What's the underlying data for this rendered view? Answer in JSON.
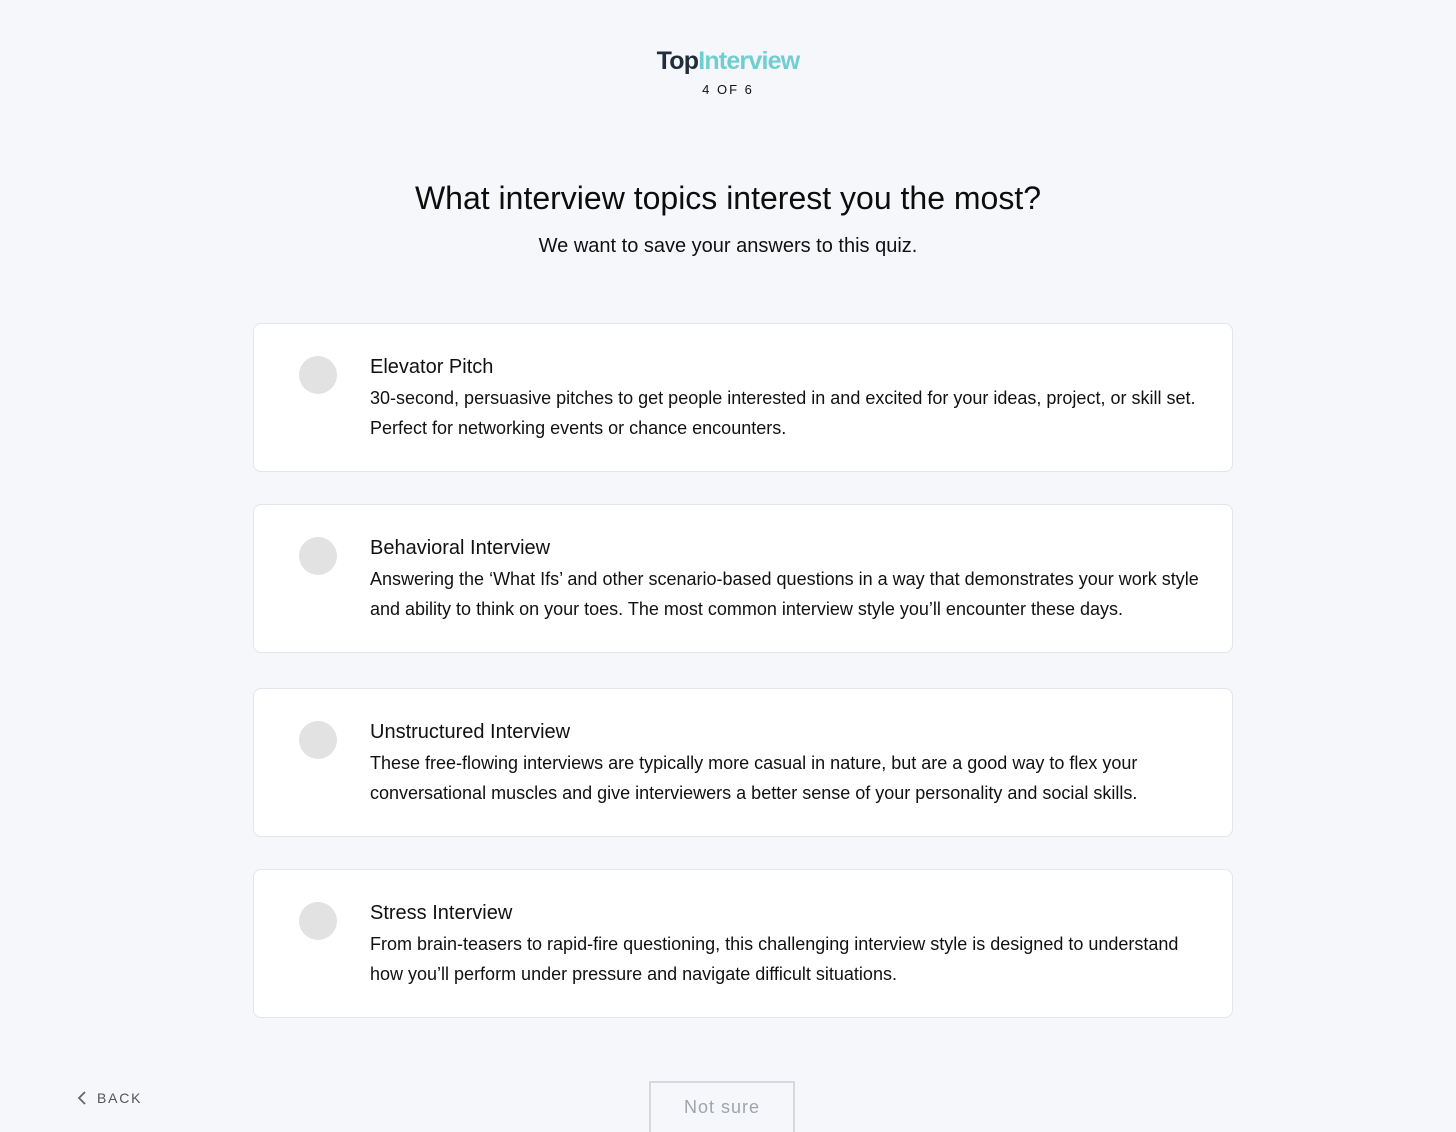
{
  "brand": {
    "name_part1": "Top",
    "name_part2": "Interview"
  },
  "progress": {
    "label": "4 OF 6",
    "current": 4,
    "total": 6
  },
  "question": {
    "title": "What interview topics interest you the most?",
    "subtitle": "We want to save your answers to this quiz."
  },
  "options": [
    {
      "title": "Elevator Pitch",
      "description": "30-second, persuasive pitches to get people interested in and excited for your ideas, project, or skill set. Perfect for networking events or chance encounters.",
      "selected": false
    },
    {
      "title": "Behavioral Interview",
      "description": "Answering the ‘What Ifs’ and other scenario-based questions in a way that demonstrates your work style and ability to think on your toes. The most common interview style you’ll encounter these days.",
      "selected": false
    },
    {
      "title": "Unstructured Interview",
      "description": "These free-flowing interviews are typically more casual in nature, but are a good way to flex your conversational muscles and give interviewers a better sense of your personality and social skills.",
      "selected": false
    },
    {
      "title": "Stress Interview",
      "description": "From brain-teasers to rapid-fire questioning, this challenging interview style is designed to understand how you’ll perform under pressure and navigate difficult situations.",
      "selected": false
    }
  ],
  "nav": {
    "back_label": "BACK",
    "back_icon": "chevron-left-icon",
    "not_sure_label": "Not sure"
  },
  "colors": {
    "background": "#f6f7fa",
    "brand_dark": "#1f2d3d",
    "brand_accent": "#6fcfd0",
    "radio_unselected": "#e2e2e2"
  }
}
